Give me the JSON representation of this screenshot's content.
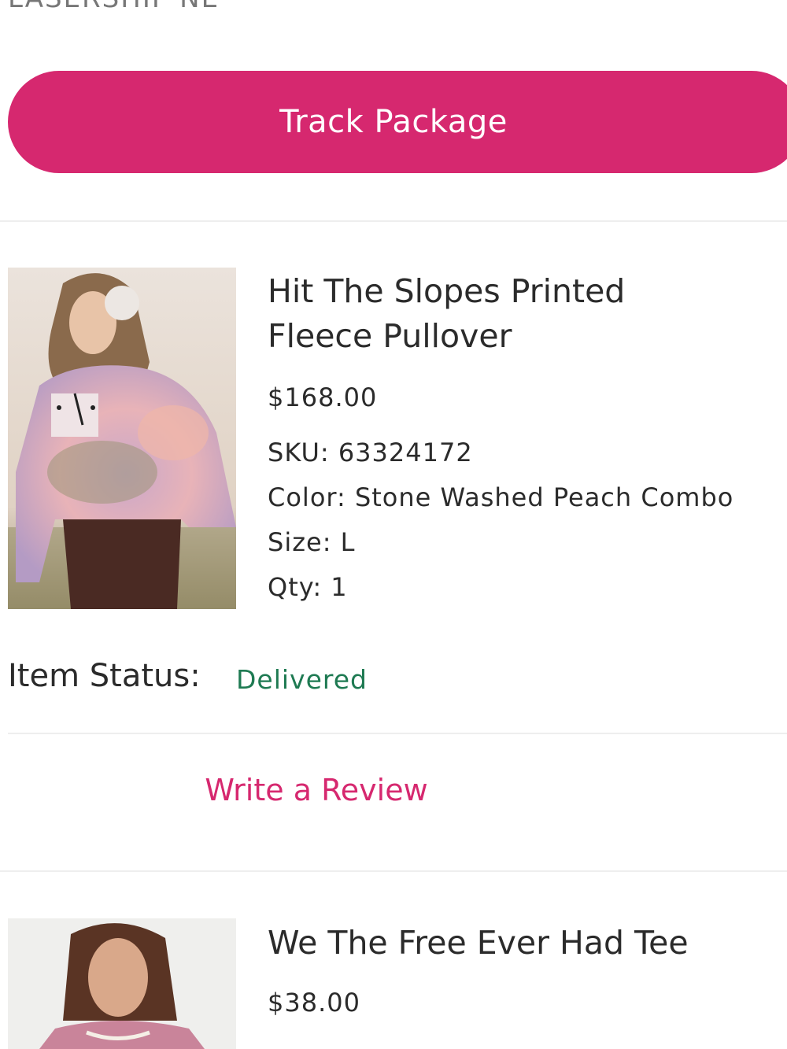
{
  "shipment": {
    "carrier": "LASERSHIP NE",
    "track_button_label": "Track Package"
  },
  "items": [
    {
      "title": "Hit The Slopes Printed Fleece Pullover",
      "title_line1": "Hit The Slopes Printed",
      "title_line2": "Fleece Pullover",
      "price": "$168.00",
      "sku_label": "SKU:",
      "sku": "63324172",
      "color_label": "Color:",
      "color": "Stone Washed Peach Combo",
      "size_label": "Size:",
      "size": "L",
      "qty_label": "Qty:",
      "qty": "1",
      "status_label": "Item Status:",
      "status": "Delivered",
      "review_label": "Write a Review"
    },
    {
      "title": "We The Free Ever Had Tee",
      "price": "$38.00"
    }
  ],
  "colors": {
    "accent": "#d6286f",
    "status_delivered": "#1e7a52",
    "divider": "#eeeeee"
  }
}
